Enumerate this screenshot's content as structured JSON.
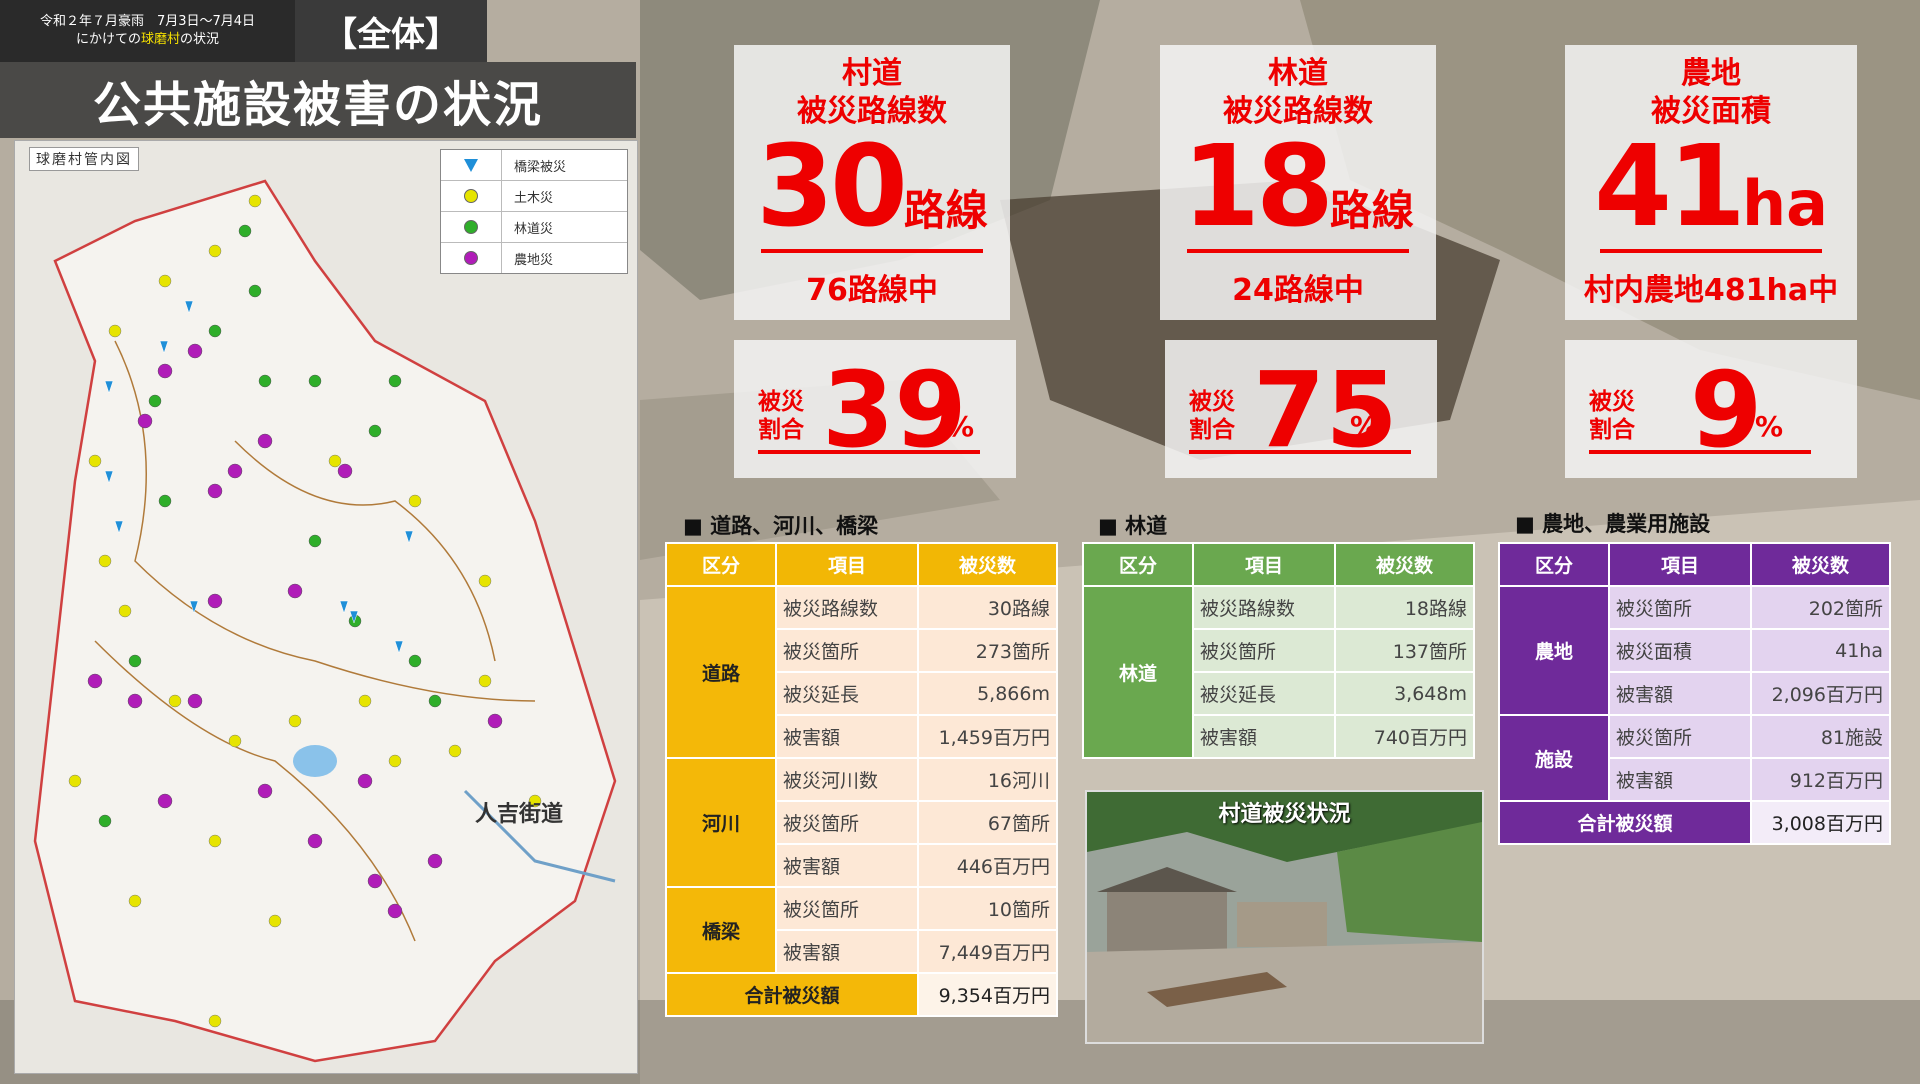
{
  "header": {
    "date_line1": "令和２年７月豪雨　7月3日～7月4日",
    "date_line2_pre": "にかけての",
    "date_line2_hl": "球磨村",
    "date_line2_post": "の状況",
    "scope": "【全体】",
    "title": "公共施設被害の状況"
  },
  "map": {
    "label": "球磨村管内図",
    "road_text": "人吉街道",
    "legend": [
      {
        "label": "橋梁被災",
        "icon": "triangle-marker",
        "color": "#1f8fd8"
      },
      {
        "label": "土木災",
        "icon": "dot",
        "color": "#e6e400"
      },
      {
        "label": "林道災",
        "icon": "dot",
        "color": "#2fae2a"
      },
      {
        "label": "農地災",
        "icon": "dot",
        "color": "#b01cb8"
      }
    ]
  },
  "stats": {
    "village_road": {
      "head1": "村道",
      "head2": "被災路線数",
      "num": "30",
      "unit": "路線",
      "sub": "76路線中",
      "pct_label1": "被災",
      "pct_label2": "割合",
      "pct": "39",
      "pct_unit": "%"
    },
    "forest_road": {
      "head1": "林道",
      "head2": "被災路線数",
      "num": "18",
      "unit": "路線",
      "sub": "24路線中",
      "pct_label1": "被災",
      "pct_label2": "割合",
      "pct": "75",
      "pct_unit": "%"
    },
    "farmland": {
      "head1": "農地",
      "head2": "被災面積",
      "num": "41",
      "unit": "ha",
      "sub": "村内農地481ha中",
      "pct_label1": "被災",
      "pct_label2": "割合",
      "pct": "9",
      "pct_unit": "%"
    }
  },
  "sections": {
    "road": "■ 道路、河川、橋梁",
    "forest": "■ 林道",
    "farm": "■ 農地、農業用施設"
  },
  "table_headers": {
    "kubun": "区分",
    "koumoku": "項目",
    "count": "被災数"
  },
  "road_table": {
    "road": {
      "cat": "道路",
      "rows": [
        [
          "被災路線数",
          "30路線"
        ],
        [
          "被災箇所",
          "273箇所"
        ],
        [
          "被災延長",
          "5,866m"
        ],
        [
          "被害額",
          "1,459百万円"
        ]
      ]
    },
    "river": {
      "cat": "河川",
      "rows": [
        [
          "被災河川数",
          "16河川"
        ],
        [
          "被災箇所",
          "67箇所"
        ],
        [
          "被害額",
          "446百万円"
        ]
      ]
    },
    "bridge": {
      "cat": "橋梁",
      "rows": [
        [
          "被災箇所",
          "10箇所"
        ],
        [
          "被害額",
          "7,449百万円"
        ]
      ]
    },
    "total_label": "合計被災額",
    "total_value": "9,354百万円"
  },
  "forest_table": {
    "cat": "林道",
    "rows": [
      [
        "被災路線数",
        "18路線"
      ],
      [
        "被災箇所",
        "137箇所"
      ],
      [
        "被災延長",
        "3,648m"
      ],
      [
        "被害額",
        "740百万円"
      ]
    ]
  },
  "farm_table": {
    "farm": {
      "cat": "農地",
      "rows": [
        [
          "被災箇所",
          "202箇所"
        ],
        [
          "被災面積",
          "41ha"
        ],
        [
          "被害額",
          "2,096百万円"
        ]
      ]
    },
    "facility": {
      "cat": "施設",
      "rows": [
        [
          "被災箇所",
          "81施設"
        ],
        [
          "被害額",
          "912百万円"
        ]
      ]
    },
    "total_label": "合計被災額",
    "total_value": "3,008百万円"
  },
  "photo": {
    "title": "村道被災状況"
  }
}
